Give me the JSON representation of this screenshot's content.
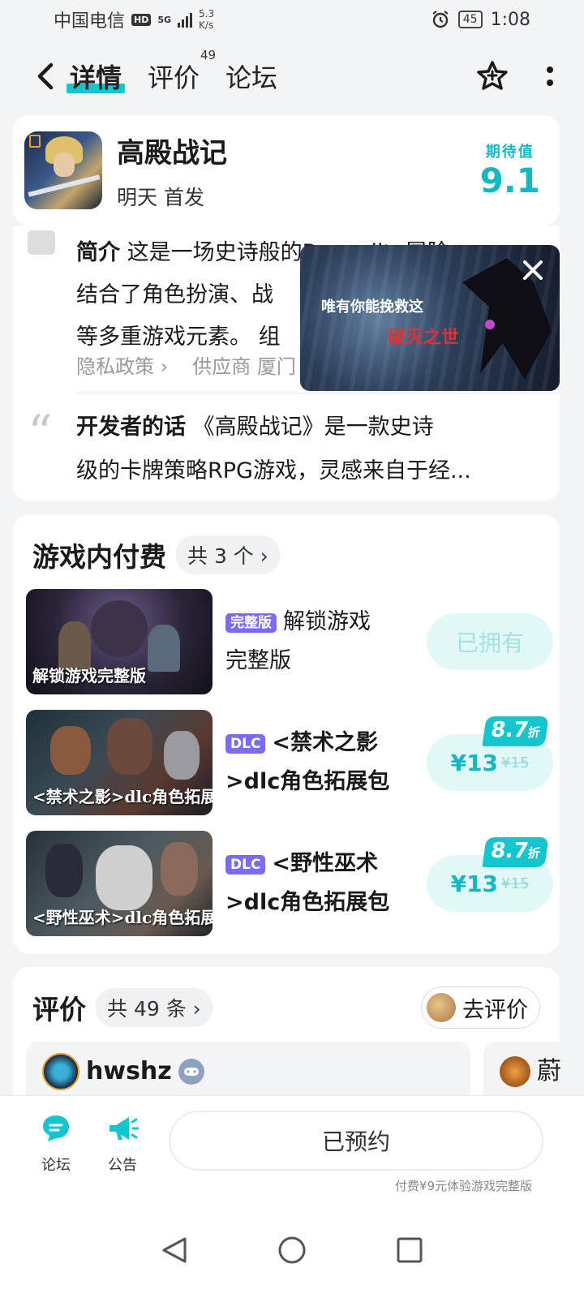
{
  "status_bar": {
    "carrier": "中国电信",
    "hd": "HD",
    "signal": "5G",
    "net_speed_value": "5.3",
    "net_speed_unit": "K/s",
    "battery": "45",
    "time": "1:08"
  },
  "nav": {
    "tabs": [
      {
        "label": "详情",
        "active": true
      },
      {
        "label": "评价",
        "count": "49"
      },
      {
        "label": "论坛"
      }
    ]
  },
  "game": {
    "title": "高殿战记",
    "release": "明天 首发",
    "expect_label": "期待值",
    "expect_score": "9.1"
  },
  "intro": {
    "heading": "简介",
    "line1": "这是一场史诗般的Roguelite冒险",
    "line2": "结合了角色扮演、战",
    "line3": "等多重游戏元素。 组",
    "privacy": "隐私政策 ›",
    "supplier": "供应商 厦门"
  },
  "dev_words": {
    "heading": "开发者的话",
    "line1": "《高殿战记》是一款史诗",
    "line2": "级的卡牌策略RPG游戏，灵感来自于经..."
  },
  "video": {
    "line1": "唯有你能挽救这",
    "line2": "破灭之世"
  },
  "iap": {
    "title": "游戏内付费",
    "count": "共 3 个 ›",
    "items": [
      {
        "thumb_caption": "解锁游戏完整版",
        "tag": "完整版",
        "name_line1": "解锁游戏",
        "name_line2": "完整版",
        "status": "已拥有"
      },
      {
        "thumb_caption": "<禁术之影>dlc角色拓展包",
        "tag": "DLC",
        "name_line1": "<禁术之影",
        "name_line2": ">dlc角色拓展包",
        "price": "¥13",
        "old_price": "¥15",
        "discount": "8.7",
        "discount_unit": "折"
      },
      {
        "thumb_caption": "<野性巫术>dlc角色拓展包",
        "tag": "DLC",
        "name_line1": "<野性巫术",
        "name_line2": ">dlc角色拓展包",
        "price": "¥13",
        "old_price": "¥15",
        "discount": "8.7",
        "discount_unit": "折"
      }
    ]
  },
  "reviews": {
    "title": "评价",
    "count": "共 49 条 ›",
    "write_label": "去评价",
    "items": [
      {
        "user": "hwshz"
      },
      {
        "user": "蔚"
      }
    ]
  },
  "action_bar": {
    "forum_label": "论坛",
    "notice_label": "公告",
    "reserve_label": "已预约",
    "trial_note": "付费¥9元体验游戏完整版"
  },
  "colors": {
    "accent": "#15c5ce",
    "tag_purple": "#7a6cf0"
  }
}
